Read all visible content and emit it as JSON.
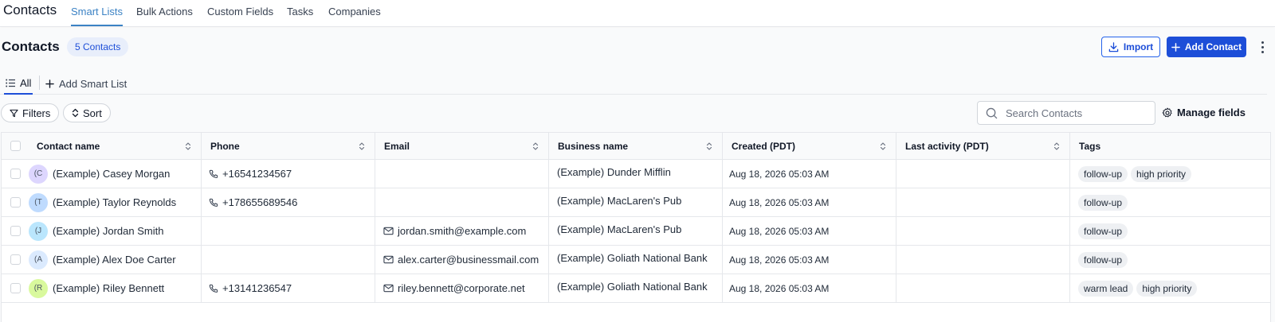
{
  "app": {
    "title": "Contacts"
  },
  "nav": {
    "tabs": [
      "Smart Lists",
      "Bulk Actions",
      "Custom Fields",
      "Tasks",
      "Companies"
    ],
    "active": "Smart Lists"
  },
  "header": {
    "title": "Contacts",
    "count_badge": "5 Contacts",
    "import_label": "Import",
    "add_label": "Add Contact"
  },
  "smart_lists": {
    "all_label": "All",
    "add_label": "Add Smart List"
  },
  "toolbar": {
    "filters_label": "Filters",
    "sort_label": "Sort",
    "search_placeholder": "Search Contacts",
    "manage_fields_label": "Manage fields"
  },
  "table": {
    "columns": [
      "Contact name",
      "Phone",
      "Email",
      "Business name",
      "Created (PDT)",
      "Last activity (PDT)",
      "Tags"
    ],
    "rows": [
      {
        "initials": "(C",
        "avatar_color": "#ddd6fe",
        "name": "(Example) Casey Morgan",
        "phone": "+16541234567",
        "email": "",
        "business": "(Example) Dunder Mifflin",
        "created": "Aug 18, 2026 05:03 AM",
        "last_activity": "",
        "tags": [
          "follow-up",
          "high priority"
        ]
      },
      {
        "initials": "(T",
        "avatar_color": "#bfdbfe",
        "name": "(Example) Taylor Reynolds",
        "phone": "+178655689546",
        "email": "",
        "business": "(Example) MacLaren's Pub",
        "created": "Aug 18, 2026 05:03 AM",
        "last_activity": "",
        "tags": [
          "follow-up"
        ]
      },
      {
        "initials": "(J",
        "avatar_color": "#bae6fd",
        "name": "(Example) Jordan Smith",
        "phone": "",
        "email": "jordan.smith@example.com",
        "business": "(Example) MacLaren's Pub",
        "created": "Aug 18, 2026 05:03 AM",
        "last_activity": "",
        "tags": [
          "follow-up"
        ]
      },
      {
        "initials": "(A",
        "avatar_color": "#dbeafe",
        "name": "(Example) Alex Doe Carter",
        "phone": "",
        "email": "alex.carter@businessmail.com",
        "business": "(Example) Goliath National Bank",
        "created": "Aug 18, 2026 05:03 AM",
        "last_activity": "",
        "tags": [
          "follow-up"
        ]
      },
      {
        "initials": "(R",
        "avatar_color": "#d9f99d",
        "name": "(Example) Riley Bennett",
        "phone": "+13141236547",
        "email": "riley.bennett@corporate.net",
        "business": "(Example) Goliath National Bank",
        "created": "Aug 18, 2026 05:03 AM",
        "last_activity": "",
        "tags": [
          "warm lead",
          "high priority"
        ]
      }
    ]
  },
  "colors": {
    "accent": "#1d4ed8",
    "tab_active": "#3b82c4",
    "badge_bg": "#e8eefb"
  }
}
